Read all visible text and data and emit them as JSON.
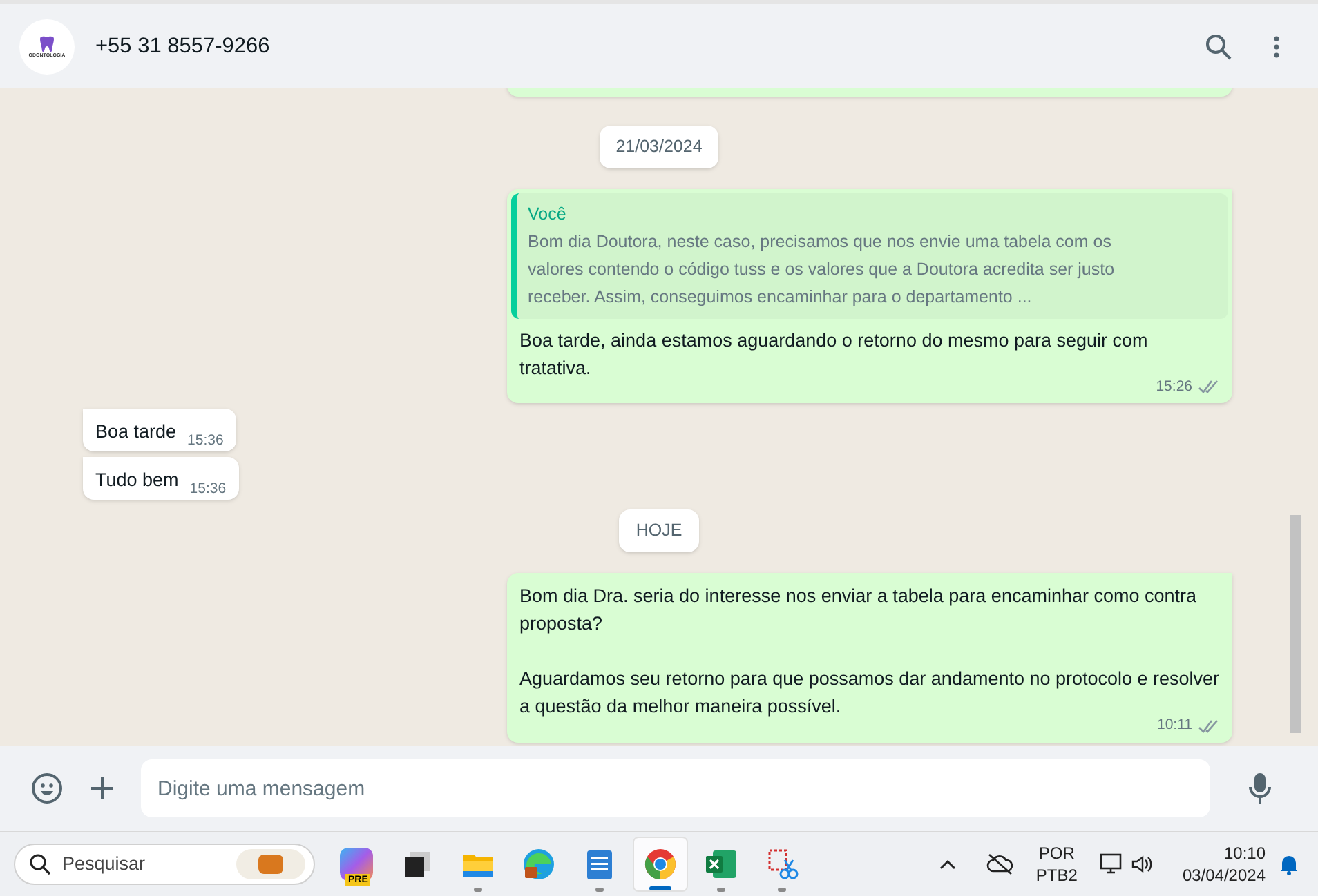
{
  "header": {
    "contact": "+55 31 8557-9266",
    "avatar_text": "ODONTOLOGIA"
  },
  "messages": [
    {
      "kind": "clipped"
    },
    {
      "kind": "date",
      "text": "21/03/2024"
    },
    {
      "kind": "outgoing",
      "quote_author": "Você",
      "quote_text": "Bom dia Doutora, neste caso, precisamos que nos envie uma tabela com os valores contendo o código tuss e os valores que a Doutora acredita ser justo receber. Assim, conseguimos encaminhar para o departamento ...",
      "paragraphs": [
        "Boa tarde, ainda estamos aguardando o retorno do mesmo para seguir com tratativa."
      ],
      "time": "15:26",
      "read": true
    },
    {
      "kind": "incoming",
      "paragraphs": [
        "Boa tarde"
      ],
      "time": "15:36"
    },
    {
      "kind": "incoming",
      "paragraphs": [
        "Tudo bem"
      ],
      "time": "15:36"
    },
    {
      "kind": "date",
      "text": "HOJE"
    },
    {
      "kind": "outgoing",
      "paragraphs": [
        "Bom dia Dra. seria do interesse nos enviar a tabela para encaminhar como contra proposta?",
        "Aguardamos seu retorno para que possamos dar andamento no protocolo e resolver a questão da melhor maneira possível."
      ],
      "time": "10:11",
      "read": true
    }
  ],
  "composer": {
    "placeholder": "Digite uma mensagem"
  },
  "taskbar": {
    "search_placeholder": "Pesquisar",
    "apps": [
      {
        "kind": "copilot",
        "badge": "PRE",
        "running": false,
        "selected": false
      },
      {
        "kind": "taskview",
        "running": false,
        "selected": false
      },
      {
        "kind": "files",
        "running": true,
        "selected": false
      },
      {
        "kind": "edge",
        "running": false,
        "selected": false
      },
      {
        "kind": "notepad",
        "running": true,
        "selected": false
      },
      {
        "kind": "chrome",
        "running": true,
        "selected": true
      },
      {
        "kind": "excel",
        "running": true,
        "selected": false
      },
      {
        "kind": "snip",
        "running": true,
        "selected": false
      }
    ],
    "language": "POR",
    "layout": "PTB2",
    "time": "10:10",
    "date": "03/04/2024"
  }
}
